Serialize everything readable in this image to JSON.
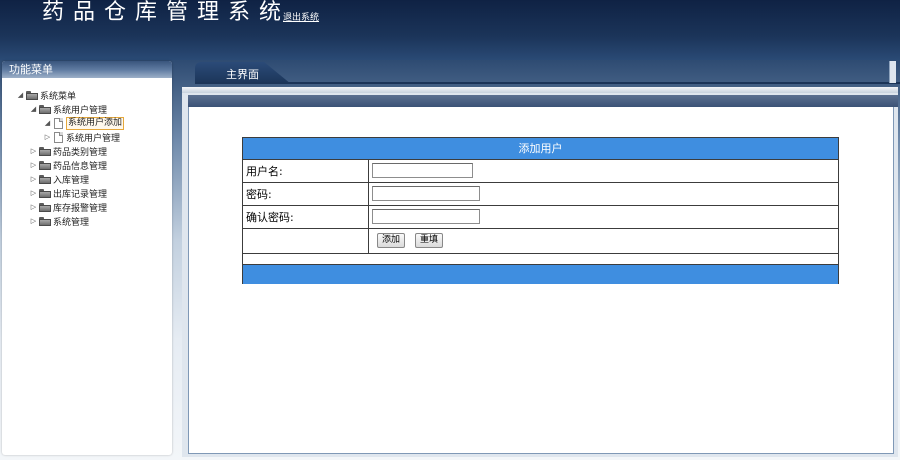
{
  "header": {
    "app_title": "药品仓库管理系统",
    "logout_label": "退出系统"
  },
  "sidebar": {
    "title": "功能菜单",
    "tree": {
      "root": "系统菜单",
      "items": [
        {
          "label": "系统用户管理",
          "expanded": true
        },
        {
          "label": "系统用户添加",
          "selected": true
        },
        {
          "label": "系统用户管理"
        },
        {
          "label": "药品类别管理"
        },
        {
          "label": "药品信息管理"
        },
        {
          "label": "入库管理"
        },
        {
          "label": "出库记录管理"
        },
        {
          "label": "库存报警管理"
        },
        {
          "label": "系统管理"
        }
      ]
    }
  },
  "tabs": {
    "main_label": "主界面"
  },
  "form": {
    "title": "添加用户",
    "username_label": "用户名:",
    "password_label": "密码:",
    "confirm_label": "确认密码:",
    "username_value": "",
    "password_value": "",
    "confirm_value": "",
    "add_button": "添加",
    "reset_button": "重填"
  },
  "colors": {
    "header_dark": "#1b3459",
    "form_header_blue": "#3f8ee0",
    "selected_border": "#e5a83c"
  }
}
